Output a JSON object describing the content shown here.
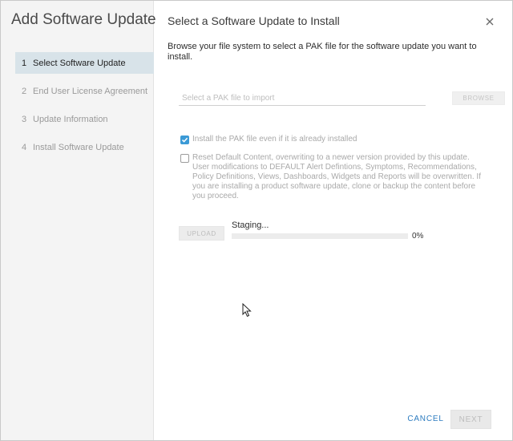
{
  "sidebar": {
    "title": "Add Software Update",
    "steps": [
      {
        "number": "1",
        "label": "Select Software Update",
        "active": true
      },
      {
        "number": "2",
        "label": "End User License Agreement",
        "active": false
      },
      {
        "number": "3",
        "label": "Update Information",
        "active": false
      },
      {
        "number": "4",
        "label": "Install Software Update",
        "active": false
      }
    ]
  },
  "main": {
    "title": "Select a Software Update to Install",
    "close_icon": "close-icon",
    "description": "Browse your file system to select a PAK file for the software update you want to install.",
    "file_input": {
      "value": "",
      "placeholder": "Select a PAK file to import"
    },
    "browse_label": "BROWSE",
    "options": [
      {
        "label": "Install the PAK file even if it is already installed",
        "checked": true
      },
      {
        "label": "Reset Default Content, overwriting to a newer version provided by this update. User modifications to DEFAULT Alert Defintions, Symptoms, Recommendations, Policy Definitions, Views, Dashboards, Widgets and Reports will be overwritten. If you are installing a product software update, clone or backup the content before you proceed.",
        "checked": false
      }
    ],
    "upload_label": "UPLOAD",
    "staging": {
      "status": "Staging...",
      "progress_percent": 0,
      "progress_text": "0%"
    }
  },
  "footer": {
    "cancel_label": "CANCEL",
    "next_label": "NEXT"
  },
  "colors": {
    "accent": "#3b9ad6",
    "link": "#2d7cc0",
    "active_step_bg": "#d8e3e9",
    "sidebar_bg": "#f4f4f4"
  }
}
